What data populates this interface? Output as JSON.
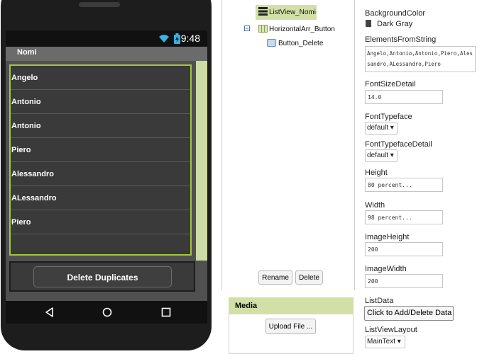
{
  "phone": {
    "status_time": "9:48",
    "title": "Nomi",
    "list_items": [
      "Angelo",
      "Antonio",
      "Antonio",
      "Piero",
      "Alessandro",
      "ALessandro",
      "Piero"
    ],
    "delete_button": "Delete Duplicates"
  },
  "tree": {
    "items": [
      {
        "label": "ListView_Nomi",
        "selected": true
      },
      {
        "label": "HorizontalArr_Button",
        "expanded": true
      },
      {
        "label": "Button_Delete"
      }
    ],
    "rename_label": "Rename",
    "delete_label": "Delete"
  },
  "media": {
    "title": "Media",
    "upload_label": "Upload File ..."
  },
  "properties": {
    "background_color_label": "BackgroundColor",
    "background_color_value": "Dark Gray",
    "elements_label": "ElementsFromString",
    "elements_value": "Angelo,Antonio,Antonio,Piero,Alessandro,ALessandro,Piero",
    "font_size_detail_label": "FontSizeDetail",
    "font_size_detail_value": "14.0",
    "font_typeface_label": "FontTypeface",
    "font_typeface_value": "default ▾",
    "font_typeface_detail_label": "FontTypefaceDetail",
    "font_typeface_detail_value": "default ▾",
    "height_label": "Height",
    "height_value": "80 percent...",
    "width_label": "Width",
    "width_value": "98 percent...",
    "image_height_label": "ImageHeight",
    "image_height_value": "200",
    "image_width_label": "ImageWidth",
    "image_width_value": "200",
    "list_data_label": "ListData",
    "list_data_button": "Click to Add/Delete Data",
    "list_view_layout_label": "ListViewLayout",
    "list_view_layout_value": "MainText ▾"
  },
  "colors": {
    "accent": "#a4c639",
    "selected_bg": "#d2e0a8",
    "dark_gray": "#444444"
  }
}
